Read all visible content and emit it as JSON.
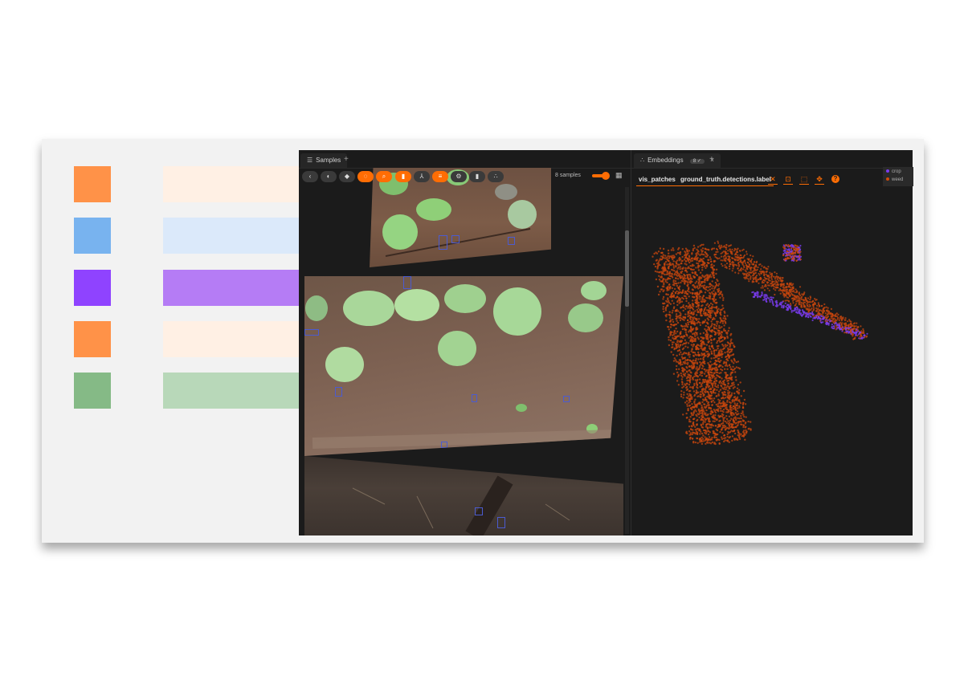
{
  "legend_swatches": [
    {
      "swatch": "#ff9248",
      "bar": "#fff0e4"
    },
    {
      "swatch": "#78b3ef",
      "bar": "#dbe9fa"
    },
    {
      "swatch": "#8f43ff",
      "bar": "#b57cf5"
    },
    {
      "swatch": "#ff9248",
      "bar": "#fff0e4"
    },
    {
      "swatch": "#85ba86",
      "bar": "#b8d8b9"
    }
  ],
  "samples_panel": {
    "tab_label": "Samples",
    "count_label": "8 samples"
  },
  "embeddings_panel": {
    "tab_label": "Embeddings",
    "badge": "8 ✓",
    "brain_key": "vis_patches",
    "color_by": "ground_truth.detections.label",
    "legend": [
      {
        "label": "crop",
        "color": "#7b3cf0"
      },
      {
        "label": "weed",
        "color": "#d04a0a"
      }
    ]
  },
  "accent_color": "#ff6d04",
  "icons": {
    "toolbar": [
      "chevron-left-icon",
      "palette-icon",
      "tag-icon",
      "lasso-icon",
      "search-icon",
      "bookmark-icon",
      "merge-icon",
      "list-icon",
      "gear-icon",
      "bar-chart-icon",
      "scatter-icon"
    ],
    "embeddings": [
      "clear-icon",
      "fit-icon",
      "select-icon",
      "move-icon",
      "help-icon"
    ]
  },
  "plus_label": "+",
  "close_label": "×",
  "help_label": "?"
}
